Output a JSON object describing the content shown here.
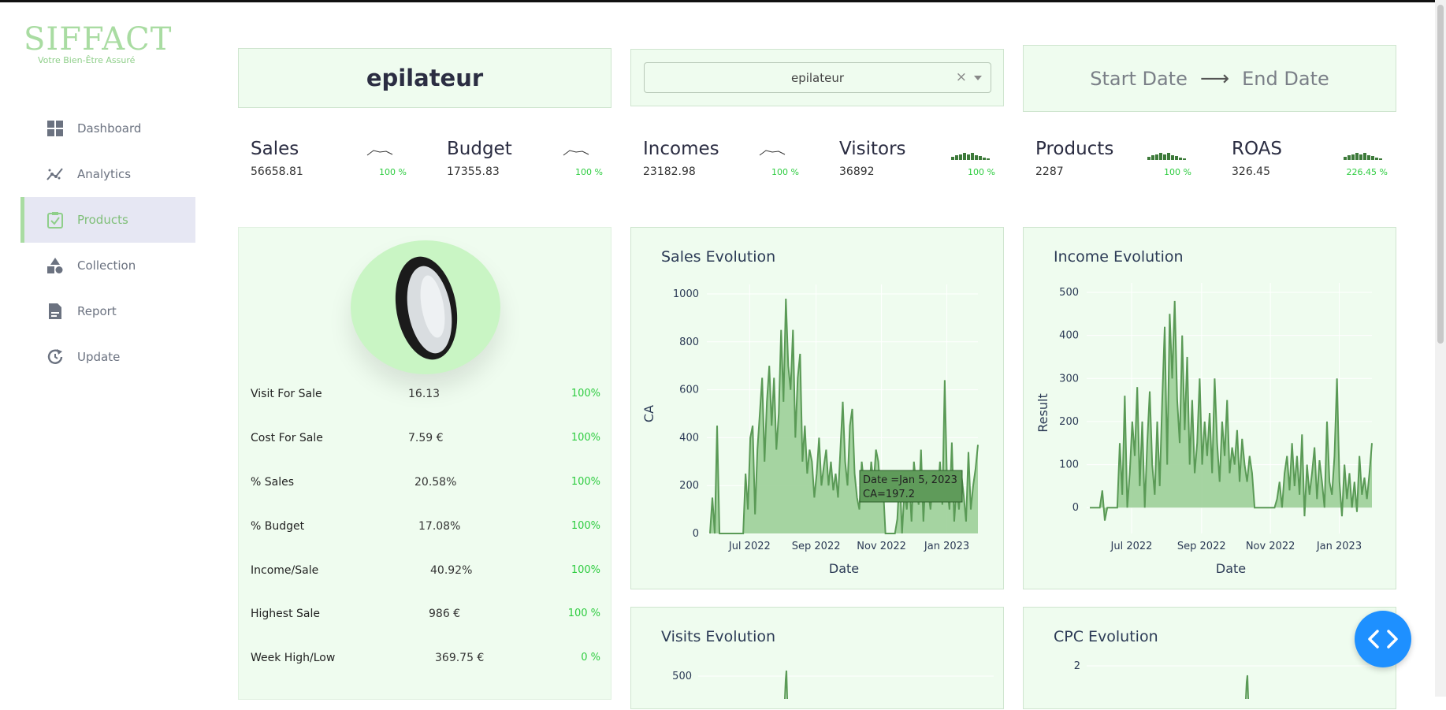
{
  "brand": {
    "logo_text": "SIFFACT",
    "tagline": "Votre Bien-Être Assuré",
    "accent": "#a9dca2"
  },
  "sidebar": {
    "items": [
      {
        "label": "Dashboard",
        "icon": "grid-icon",
        "active": false
      },
      {
        "label": "Analytics",
        "icon": "trend-icon",
        "active": false
      },
      {
        "label": "Products",
        "icon": "clipboard-check-icon",
        "active": true
      },
      {
        "label": "Collection",
        "icon": "shapes-icon",
        "active": false
      },
      {
        "label": "Report",
        "icon": "report-icon",
        "active": false
      },
      {
        "label": "Update",
        "icon": "refresh-icon",
        "active": false
      }
    ]
  },
  "header": {
    "product_title": "epilateur",
    "select": {
      "value": "epilateur",
      "clear": "×"
    },
    "date_range": {
      "start": "Start Date",
      "arrow": "⟶",
      "end": "End Date"
    }
  },
  "kpis": [
    {
      "name": "Sales",
      "value": "56658.81",
      "pct": "100 %",
      "spark": "line"
    },
    {
      "name": "Budget",
      "value": "17355.83",
      "pct": "100 %",
      "spark": "line"
    },
    {
      "name": "Incomes",
      "value": "23182.98",
      "pct": "100 %",
      "spark": "line"
    },
    {
      "name": "Visitors",
      "value": "36892",
      "pct": "100 %",
      "spark": "bar"
    },
    {
      "name": "Products",
      "value": "2287",
      "pct": "100 %",
      "spark": "bar"
    },
    {
      "name": "ROAS",
      "value": "326.45",
      "pct": "226.45 %",
      "spark": "bar"
    }
  ],
  "product_stats": [
    {
      "label": "Visit For Sale",
      "value": "16.13",
      "pct": "100%"
    },
    {
      "label": "Cost For Sale",
      "value": "7.59 €",
      "pct": "100%"
    },
    {
      "label": "% Sales",
      "value": "20.58%",
      "pct": "100%"
    },
    {
      "label": "% Budget",
      "value": "17.08%",
      "pct": "100%"
    },
    {
      "label": "Income/Sale",
      "value": "40.92%",
      "pct": "100%"
    },
    {
      "label": "Highest Sale",
      "value": "986 €",
      "pct": "100 %"
    },
    {
      "label": "Week High/Low",
      "value": "369.75 €",
      "pct": "0 %"
    }
  ],
  "chart_data": [
    {
      "type": "area",
      "title": "Sales Evolution",
      "xlabel": "Date",
      "ylabel": "CA",
      "x_ticks": [
        "Jul 2022",
        "Sep 2022",
        "Nov 2022",
        "Jan 2023"
      ],
      "y_ticks": [
        "0",
        "200",
        "400",
        "600",
        "800",
        "1000"
      ],
      "ylim": [
        0,
        1000
      ],
      "x_range": [
        "2022-05-25",
        "2023-01-30"
      ],
      "tooltip": {
        "line1": "Date =Jan 5, 2023",
        "line2": "CA=197.2"
      },
      "series": [
        {
          "values": [
            0,
            150,
            0,
            450,
            0,
            0,
            0,
            0,
            0,
            0,
            0,
            0,
            0,
            0,
            0,
            250,
            100,
            400,
            450,
            80,
            350,
            500,
            650,
            300,
            550,
            700,
            450,
            650,
            350,
            500,
            850,
            550,
            980,
            700,
            600,
            850,
            400,
            650,
            750,
            300,
            450,
            250,
            350,
            300,
            150,
            250,
            400,
            200,
            280,
            350,
            200,
            300,
            180,
            250,
            150,
            350,
            550,
            300,
            200,
            450,
            520,
            250,
            150,
            100,
            300,
            200,
            250,
            150,
            300,
            200,
            350,
            300,
            150,
            200,
            0,
            0,
            0,
            0,
            0,
            60,
            250,
            0,
            180,
            100,
            230,
            50,
            300,
            200,
            120,
            350,
            50,
            250,
            180,
            100,
            220,
            260,
            150,
            300,
            120,
            640,
            200,
            100,
            380,
            50,
            200,
            100,
            250,
            160,
            50,
            340,
            100,
            200,
            270,
            370
          ]
        }
      ],
      "colors": {
        "line": "#5a9a56",
        "fill": "#9ccf98"
      }
    },
    {
      "type": "area",
      "title": "Income Evolution",
      "xlabel": "Date",
      "ylabel": "Result",
      "x_ticks": [
        "Jul 2022",
        "Sep 2022",
        "Nov 2022",
        "Jan 2023"
      ],
      "y_ticks": [
        "0",
        "100",
        "200",
        "300",
        "400",
        "500"
      ],
      "ylim": [
        -60,
        500
      ],
      "x_range": [
        "2022-05-25",
        "2023-01-30"
      ],
      "series": [
        {
          "values": [
            0,
            0,
            0,
            0,
            0,
            40,
            -30,
            0,
            0,
            0,
            0,
            0,
            150,
            30,
            260,
            0,
            80,
            200,
            120,
            280,
            50,
            200,
            0,
            150,
            270,
            100,
            30,
            200,
            50,
            250,
            420,
            100,
            450,
            300,
            480,
            250,
            150,
            400,
            180,
            350,
            100,
            250,
            80,
            150,
            300,
            100,
            200,
            120,
            220,
            80,
            300,
            150,
            60,
            200,
            120,
            250,
            80,
            140,
            100,
            180,
            60,
            160,
            100,
            60,
            120,
            80,
            0,
            0,
            0,
            0,
            0,
            0,
            0,
            0,
            0,
            20,
            60,
            0,
            80,
            120,
            40,
            150,
            50,
            120,
            30,
            170,
            -20,
            100,
            30,
            80,
            140,
            20,
            110,
            60,
            0,
            200,
            60,
            30,
            120,
            300,
            60,
            -20,
            100,
            20,
            80,
            0,
            60,
            -10,
            120,
            30,
            70,
            20,
            80,
            150
          ]
        }
      ],
      "colors": {
        "line": "#5a9a56",
        "fill": "#9ccf98"
      }
    },
    {
      "type": "line",
      "title": "Visits Evolution",
      "y_ticks": [
        "500"
      ]
    },
    {
      "type": "line",
      "title": "CPC Evolution",
      "y_ticks": [
        "2"
      ]
    }
  ]
}
